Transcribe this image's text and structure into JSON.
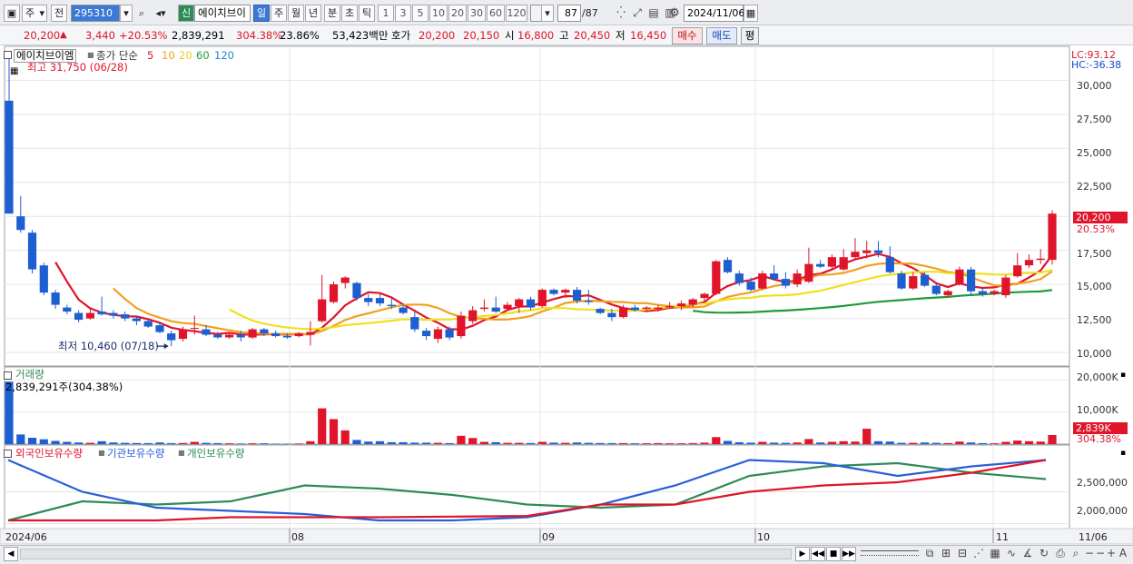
{
  "toolbar": {
    "period_type": "주",
    "prev_label": "전",
    "code": "295310",
    "market_badge": "신",
    "stock_name": "에이치브이",
    "periods": [
      "일",
      "주",
      "월",
      "년",
      "분",
      "초",
      "틱"
    ],
    "selected_period": "일",
    "intervals": [
      "1",
      "3",
      "5",
      "10",
      "20",
      "30",
      "60",
      "120"
    ],
    "count_current": "87",
    "count_total": "/87",
    "date": "2024/11/06"
  },
  "quote": {
    "price": "20,200",
    "arrow": "▲",
    "change": "3,440",
    "change_pct": "+20.53%",
    "volume": "2,839,291",
    "volume_ratio": "304.38%",
    "turnover": "23.86%",
    "amount": "53,423백만",
    "bid_label": "호가",
    "ask": "20,200",
    "bid": "20,150",
    "open_label": "시",
    "open": "16,800",
    "high_label": "고",
    "high": "20,450",
    "low_label": "저",
    "low": "16,450",
    "buy_label": "매수",
    "sell_label": "매도",
    "eval_label": "평"
  },
  "price_panel": {
    "name": "에이치브이엠",
    "ma_title": "종가 단순",
    "ma_periods": [
      "5",
      "10",
      "20",
      "60",
      "120"
    ],
    "ma_colors": [
      "#e0142a",
      "#f0a020",
      "#f0e020",
      "#1f9a3a",
      "#1e88c8"
    ],
    "high_note": "최고 31,750 (06/28)",
    "low_note": "최저 10,460 (07/18)",
    "lc": "LC:93.12",
    "hc": "HC:-36.38",
    "last_price_tag": "20,200",
    "last_pct_tag": "20.53%",
    "y_ticks": [
      "30,000",
      "27,500",
      "25,000",
      "22,500",
      "20,000",
      "17,500",
      "15,000",
      "12,500",
      "10,000"
    ]
  },
  "volume_panel": {
    "title": "거래량",
    "current": "2,839,291주(304.38%)",
    "y_ticks": [
      "20,000K",
      "10,000K"
    ],
    "tag_value": "2,839K",
    "tag_pct": "304.38%"
  },
  "holding_panel": {
    "foreign": "외국인보유수량",
    "institution": "기관보유수량",
    "individual": "개인보유수량",
    "colors": {
      "foreign": "#e0142a",
      "institution": "#2a5fd8",
      "individual": "#2e8b57"
    },
    "y_ticks": [
      "2,500,000",
      "2,000,000"
    ]
  },
  "x_axis": {
    "labels": [
      "2024/06",
      "08",
      "09",
      "10",
      "11"
    ],
    "right_label": "11/06"
  },
  "colors": {
    "up": "#e0142a",
    "down": "#1d5fd0",
    "bg": "#ffffff",
    "grid": "#e4e6ea"
  },
  "chart_data": {
    "type": "candlestick",
    "candles": [
      {
        "o": 28500,
        "h": 31750,
        "l": 20200,
        "c": 20200
      },
      {
        "o": 20000,
        "h": 21500,
        "l": 18800,
        "c": 19000
      },
      {
        "o": 18800,
        "h": 19000,
        "l": 15800,
        "c": 16100
      },
      {
        "o": 16400,
        "h": 16600,
        "l": 14200,
        "c": 14400
      },
      {
        "o": 14400,
        "h": 14600,
        "l": 13200,
        "c": 13500
      },
      {
        "o": 13300,
        "h": 13500,
        "l": 12800,
        "c": 13000
      },
      {
        "o": 12900,
        "h": 13100,
        "l": 12200,
        "c": 12400
      },
      {
        "o": 12500,
        "h": 13300,
        "l": 12400,
        "c": 12900
      },
      {
        "o": 13000,
        "h": 14100,
        "l": 12700,
        "c": 12800
      },
      {
        "o": 12900,
        "h": 13100,
        "l": 12500,
        "c": 12700
      },
      {
        "o": 12800,
        "h": 13000,
        "l": 12300,
        "c": 12500
      },
      {
        "o": 12500,
        "h": 12700,
        "l": 12000,
        "c": 12300
      },
      {
        "o": 12300,
        "h": 12400,
        "l": 11800,
        "c": 11900
      },
      {
        "o": 12000,
        "h": 12200,
        "l": 11400,
        "c": 11500
      },
      {
        "o": 11400,
        "h": 11600,
        "l": 10460,
        "c": 10900
      },
      {
        "o": 11000,
        "h": 11900,
        "l": 10800,
        "c": 11700
      },
      {
        "o": 11800,
        "h": 12700,
        "l": 11300,
        "c": 11800
      },
      {
        "o": 11700,
        "h": 12000,
        "l": 11200,
        "c": 11300
      },
      {
        "o": 11300,
        "h": 11500,
        "l": 11000,
        "c": 11100
      },
      {
        "o": 11100,
        "h": 11500,
        "l": 11000,
        "c": 11300
      },
      {
        "o": 11300,
        "h": 11600,
        "l": 10800,
        "c": 11100
      },
      {
        "o": 11100,
        "h": 11800,
        "l": 11000,
        "c": 11700
      },
      {
        "o": 11700,
        "h": 11800,
        "l": 11200,
        "c": 11400
      },
      {
        "o": 11400,
        "h": 11600,
        "l": 11100,
        "c": 11200
      },
      {
        "o": 11200,
        "h": 11400,
        "l": 11000,
        "c": 11100
      },
      {
        "o": 11200,
        "h": 11500,
        "l": 11100,
        "c": 11400
      },
      {
        "o": 11300,
        "h": 12300,
        "l": 10500,
        "c": 11500
      },
      {
        "o": 12300,
        "h": 15700,
        "l": 12200,
        "c": 13900
      },
      {
        "o": 13700,
        "h": 15200,
        "l": 13600,
        "c": 15000
      },
      {
        "o": 15100,
        "h": 15600,
        "l": 14700,
        "c": 15500
      },
      {
        "o": 15100,
        "h": 15200,
        "l": 13800,
        "c": 14000
      },
      {
        "o": 14000,
        "h": 14300,
        "l": 13400,
        "c": 13700
      },
      {
        "o": 14000,
        "h": 14300,
        "l": 13400,
        "c": 13600
      },
      {
        "o": 13500,
        "h": 14100,
        "l": 13200,
        "c": 13400
      },
      {
        "o": 13300,
        "h": 13600,
        "l": 12800,
        "c": 12900
      },
      {
        "o": 12600,
        "h": 13000,
        "l": 11500,
        "c": 11700
      },
      {
        "o": 11600,
        "h": 11800,
        "l": 10900,
        "c": 11200
      },
      {
        "o": 11000,
        "h": 11900,
        "l": 10700,
        "c": 11700
      },
      {
        "o": 11700,
        "h": 11900,
        "l": 10900,
        "c": 11100
      },
      {
        "o": 11200,
        "h": 13000,
        "l": 11000,
        "c": 12700
      },
      {
        "o": 12300,
        "h": 13400,
        "l": 12100,
        "c": 13100
      },
      {
        "o": 13200,
        "h": 13900,
        "l": 13000,
        "c": 13300
      },
      {
        "o": 13300,
        "h": 14100,
        "l": 12900,
        "c": 13000
      },
      {
        "o": 13200,
        "h": 13700,
        "l": 13100,
        "c": 13500
      },
      {
        "o": 13400,
        "h": 14000,
        "l": 12900,
        "c": 13900
      },
      {
        "o": 13900,
        "h": 14100,
        "l": 13100,
        "c": 13300
      },
      {
        "o": 13400,
        "h": 14700,
        "l": 13300,
        "c": 14600
      },
      {
        "o": 14600,
        "h": 14700,
        "l": 14200,
        "c": 14300
      },
      {
        "o": 14400,
        "h": 14700,
        "l": 14000,
        "c": 14600
      },
      {
        "o": 14600,
        "h": 14800,
        "l": 13600,
        "c": 13800
      },
      {
        "o": 13800,
        "h": 14600,
        "l": 13500,
        "c": 13700
      },
      {
        "o": 13200,
        "h": 13300,
        "l": 12800,
        "c": 12900
      },
      {
        "o": 12900,
        "h": 13200,
        "l": 12300,
        "c": 12600
      },
      {
        "o": 12600,
        "h": 13500,
        "l": 12500,
        "c": 13300
      },
      {
        "o": 13300,
        "h": 13500,
        "l": 13000,
        "c": 13100
      },
      {
        "o": 13200,
        "h": 13400,
        "l": 13000,
        "c": 13300
      },
      {
        "o": 13200,
        "h": 13500,
        "l": 13000,
        "c": 13300
      },
      {
        "o": 13300,
        "h": 13700,
        "l": 13200,
        "c": 13400
      },
      {
        "o": 13400,
        "h": 13800,
        "l": 13100,
        "c": 13600
      },
      {
        "o": 13500,
        "h": 14000,
        "l": 13300,
        "c": 13900
      },
      {
        "o": 14000,
        "h": 14400,
        "l": 13700,
        "c": 14300
      },
      {
        "o": 14300,
        "h": 16800,
        "l": 14200,
        "c": 16700
      },
      {
        "o": 16800,
        "h": 17000,
        "l": 15800,
        "c": 15900
      },
      {
        "o": 15800,
        "h": 16000,
        "l": 14900,
        "c": 15100
      },
      {
        "o": 15200,
        "h": 15500,
        "l": 14500,
        "c": 14600
      },
      {
        "o": 14700,
        "h": 16000,
        "l": 14600,
        "c": 15800
      },
      {
        "o": 15800,
        "h": 16400,
        "l": 15300,
        "c": 15400
      },
      {
        "o": 15400,
        "h": 15900,
        "l": 14700,
        "c": 14900
      },
      {
        "o": 15000,
        "h": 16100,
        "l": 14800,
        "c": 15800
      },
      {
        "o": 15200,
        "h": 17700,
        "l": 15100,
        "c": 16500
      },
      {
        "o": 16500,
        "h": 16800,
        "l": 16200,
        "c": 16300
      },
      {
        "o": 16300,
        "h": 17200,
        "l": 16100,
        "c": 17000
      },
      {
        "o": 16100,
        "h": 17600,
        "l": 16000,
        "c": 17000
      },
      {
        "o": 17000,
        "h": 18400,
        "l": 16800,
        "c": 17400
      },
      {
        "o": 17300,
        "h": 18200,
        "l": 16900,
        "c": 17500
      },
      {
        "o": 17500,
        "h": 18200,
        "l": 17000,
        "c": 17300
      },
      {
        "o": 17000,
        "h": 17800,
        "l": 15800,
        "c": 15900
      },
      {
        "o": 15800,
        "h": 16000,
        "l": 14600,
        "c": 14700
      },
      {
        "o": 14700,
        "h": 15900,
        "l": 14600,
        "c": 15600
      },
      {
        "o": 15700,
        "h": 15900,
        "l": 14800,
        "c": 14900
      },
      {
        "o": 14900,
        "h": 15000,
        "l": 14200,
        "c": 14300
      },
      {
        "o": 14200,
        "h": 14600,
        "l": 14000,
        "c": 14500
      },
      {
        "o": 15000,
        "h": 16300,
        "l": 14900,
        "c": 16100
      },
      {
        "o": 16100,
        "h": 16300,
        "l": 14200,
        "c": 14500
      },
      {
        "o": 14500,
        "h": 14800,
        "l": 14100,
        "c": 14300
      },
      {
        "o": 14300,
        "h": 14600,
        "l": 14200,
        "c": 14500
      },
      {
        "o": 14200,
        "h": 15700,
        "l": 14000,
        "c": 15500
      },
      {
        "o": 15600,
        "h": 17300,
        "l": 15500,
        "c": 16400
      },
      {
        "o": 16400,
        "h": 17200,
        "l": 16200,
        "c": 16800
      },
      {
        "o": 16800,
        "h": 17600,
        "l": 16500,
        "c": 16900
      },
      {
        "o": 16800,
        "h": 20450,
        "l": 16450,
        "c": 20200
      }
    ],
    "volumes_k": [
      19500,
      3000,
      2000,
      1500,
      1000,
      700,
      500,
      400,
      900,
      500,
      400,
      350,
      300,
      500,
      300,
      350,
      700,
      400,
      300,
      250,
      200,
      250,
      250,
      150,
      150,
      200,
      900,
      11200,
      7800,
      4300,
      1300,
      800,
      900,
      600,
      600,
      450,
      450,
      400,
      300,
      2600,
      1900,
      700,
      600,
      400,
      400,
      350,
      700,
      450,
      400,
      500,
      400,
      350,
      300,
      300,
      250,
      250,
      300,
      250,
      250,
      300,
      450,
      2200,
      1000,
      600,
      450,
      700,
      450,
      400,
      500,
      1600,
      500,
      700,
      900,
      800,
      4800,
      900,
      800,
      400,
      400,
      500,
      400,
      300,
      800,
      500,
      300,
      250,
      700,
      1100,
      900,
      800,
      2839
    ],
    "holdings": {
      "foreign": [
        2050000,
        2050000,
        2050000,
        2100000,
        2100000,
        2100000,
        2110000,
        2120000,
        2300000,
        2300000,
        2500000,
        2600000,
        2650000,
        2800000,
        3000000
      ],
      "institution": [
        3000000,
        2500000,
        2250000,
        2200000,
        2150000,
        2050000,
        2050000,
        2100000,
        2300000,
        2600000,
        3000000,
        2950000,
        2750000,
        2900000,
        3000000
      ],
      "individual": [
        2050000,
        2350000,
        2300000,
        2350000,
        2600000,
        2550000,
        2450000,
        2300000,
        2250000,
        2300000,
        2750000,
        2900000,
        2950000,
        2800000,
        2700000
      ]
    }
  }
}
